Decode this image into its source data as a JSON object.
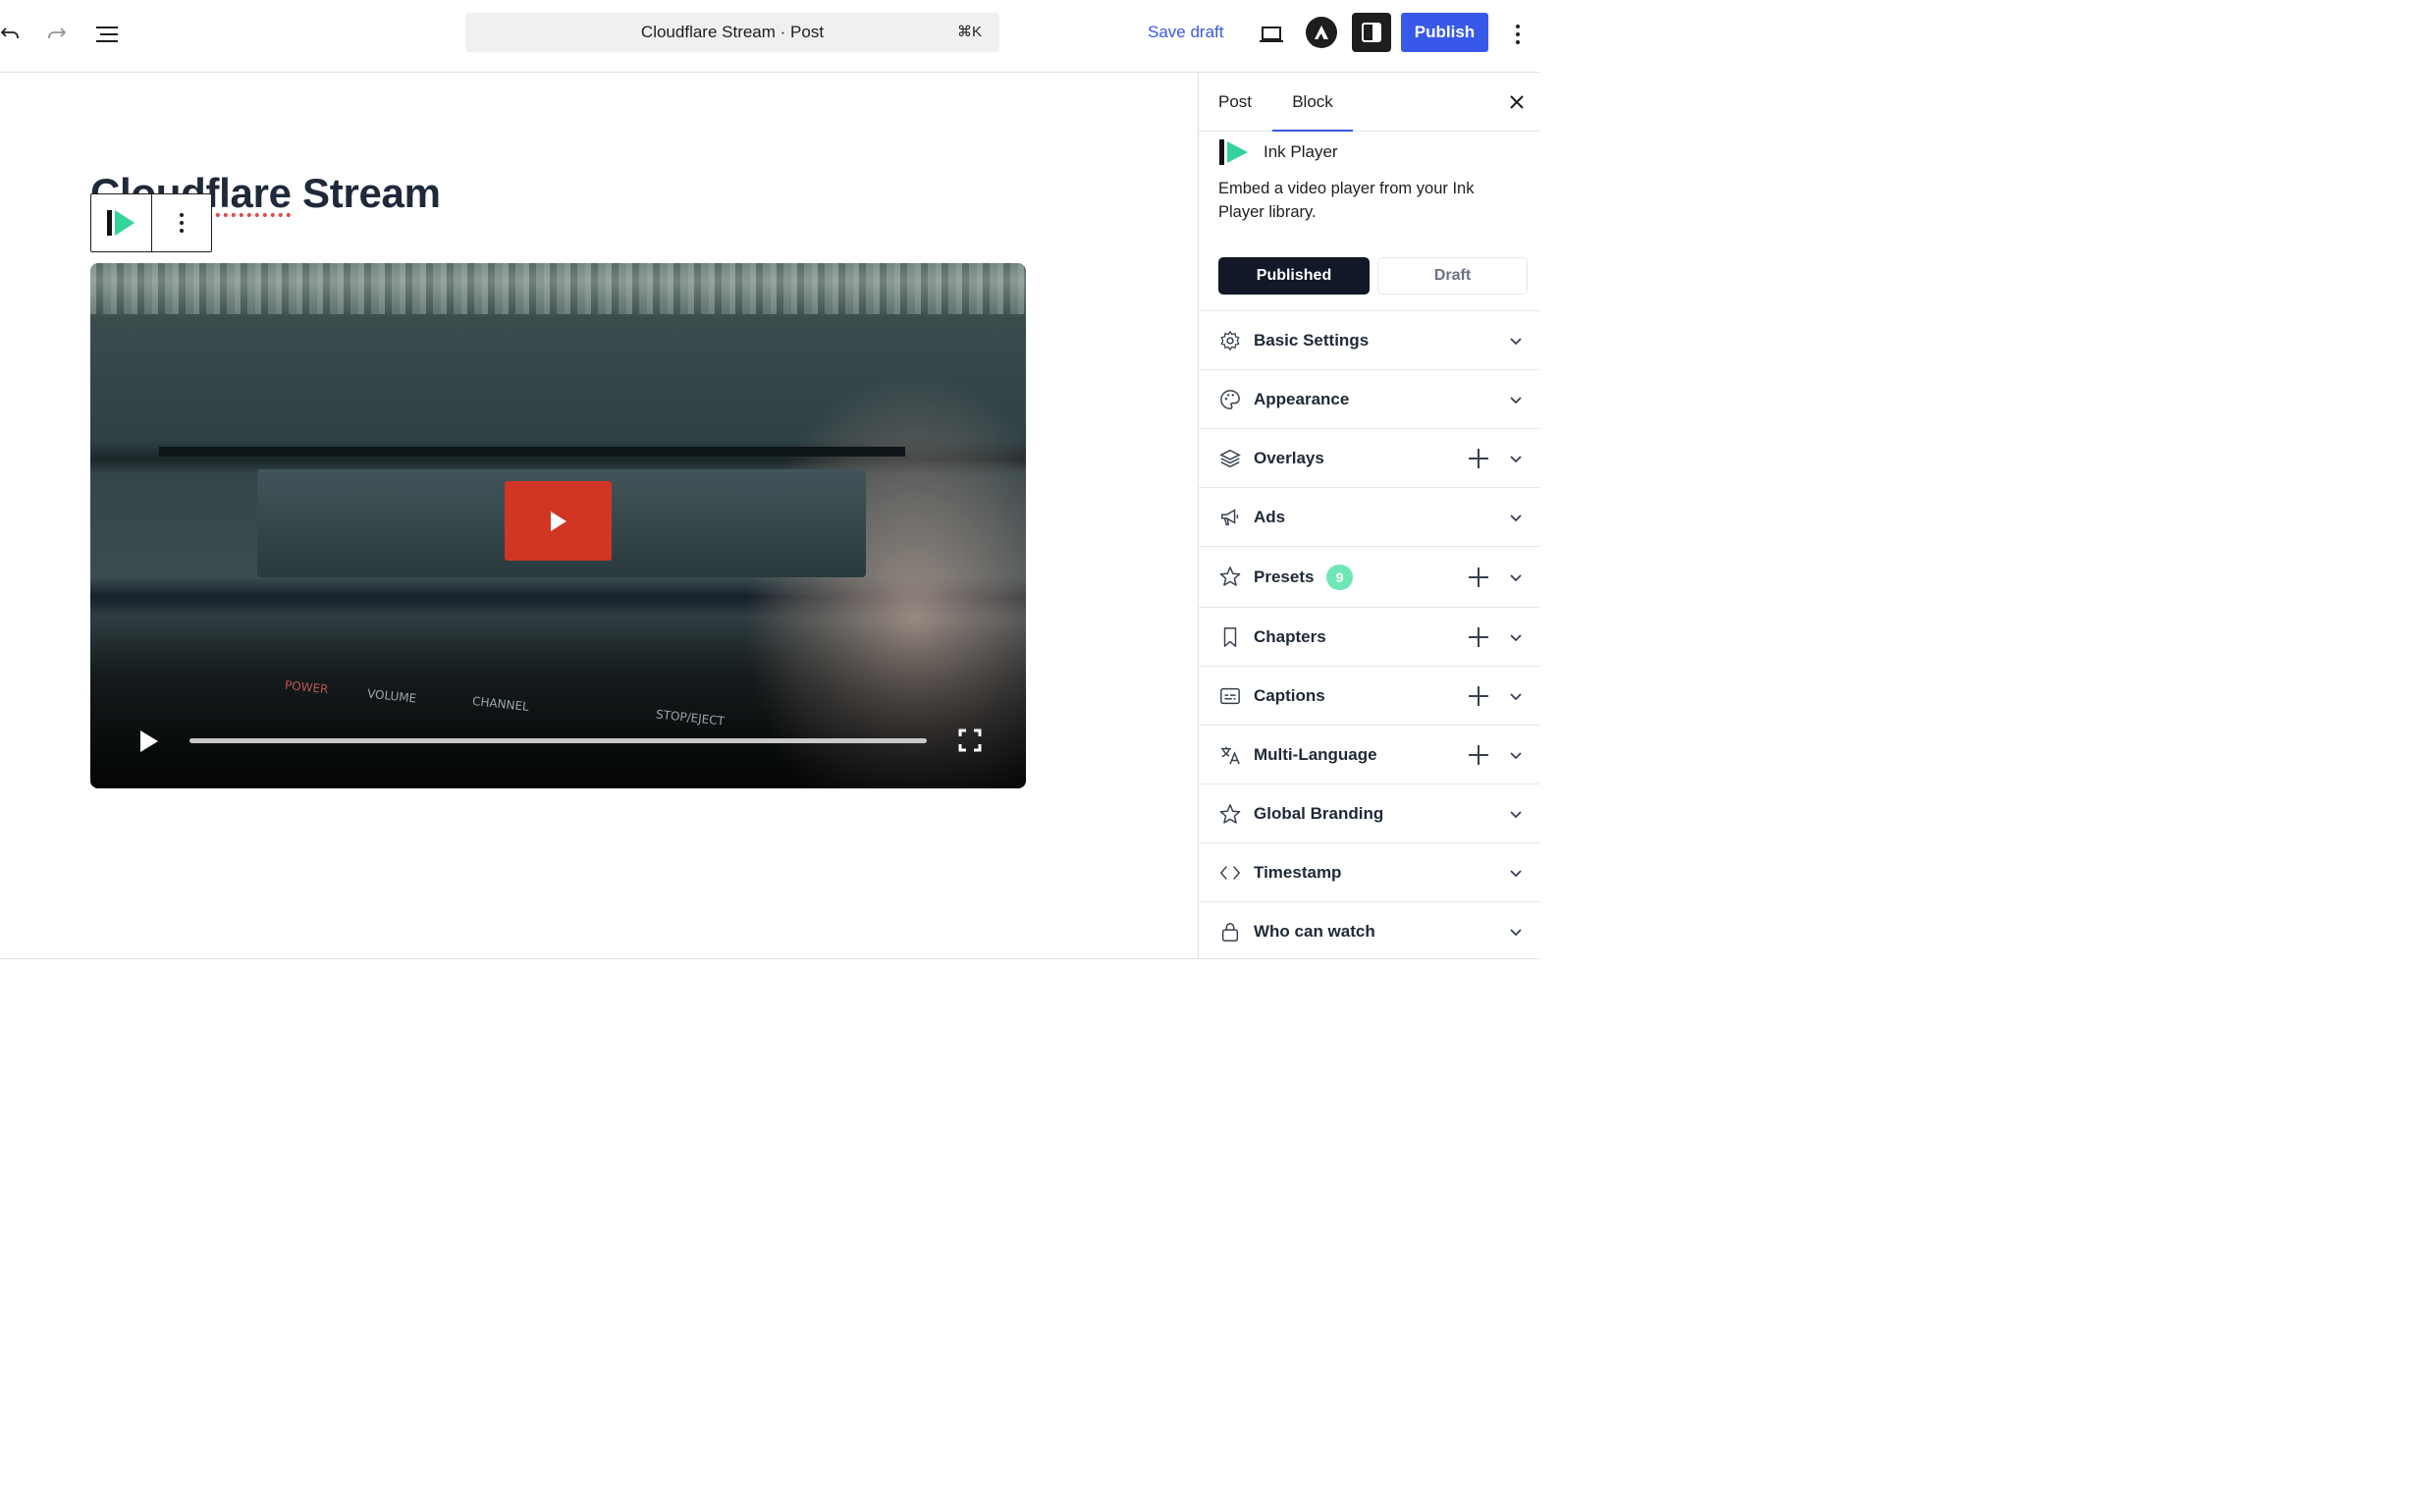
{
  "toolbar": {
    "command_title": "Cloudflare Stream · Post",
    "command_shortcut": "⌘K",
    "save_draft_label": "Save draft",
    "publish_label": "Publish",
    "icons": [
      "undo-icon",
      "redo-icon",
      "document-overview-icon",
      "preview-icon",
      "avatar-icon",
      "sidebar-toggle-icon",
      "more-options-icon"
    ]
  },
  "editor": {
    "post_title_part1": "Cloudflare",
    "post_title_part2": " Stream",
    "video": {
      "panel_labels": [
        "VOLUME",
        "CHANNEL",
        "STOP/EJECT",
        "POWER"
      ],
      "progress": 0.0,
      "accent_color": "#d13524"
    }
  },
  "sidebar": {
    "tabs": [
      {
        "label": "Post",
        "active": false
      },
      {
        "label": "Block",
        "active": true
      }
    ],
    "plugin": {
      "name": "Ink Player",
      "description": "Embed a video player from your Ink Player library."
    },
    "status": {
      "published_label": "Published",
      "draft_label": "Draft",
      "selected": "Published"
    },
    "sections": [
      {
        "label": "Basic Settings",
        "icon": "gear-icon",
        "has_add": false
      },
      {
        "label": "Appearance",
        "icon": "palette-icon",
        "has_add": false
      },
      {
        "label": "Overlays",
        "icon": "layers-icon",
        "has_add": true
      },
      {
        "label": "Ads",
        "icon": "megaphone-icon",
        "has_add": false
      },
      {
        "label": "Presets",
        "icon": "star-icon",
        "has_add": true,
        "badge": "9"
      },
      {
        "label": "Chapters",
        "icon": "bookmark-icon",
        "has_add": true
      },
      {
        "label": "Captions",
        "icon": "captions-icon",
        "has_add": true
      },
      {
        "label": "Multi-Language",
        "icon": "translate-icon",
        "has_add": true
      },
      {
        "label": "Global Branding",
        "icon": "star-icon",
        "has_add": false
      },
      {
        "label": "Timestamp",
        "icon": "code-icon",
        "has_add": false
      },
      {
        "label": "Who can watch",
        "icon": "lock-icon",
        "has_add": false
      }
    ]
  },
  "colors": {
    "accent": "#3858e9",
    "dark": "#111827",
    "badge": "#6ee7b7"
  }
}
